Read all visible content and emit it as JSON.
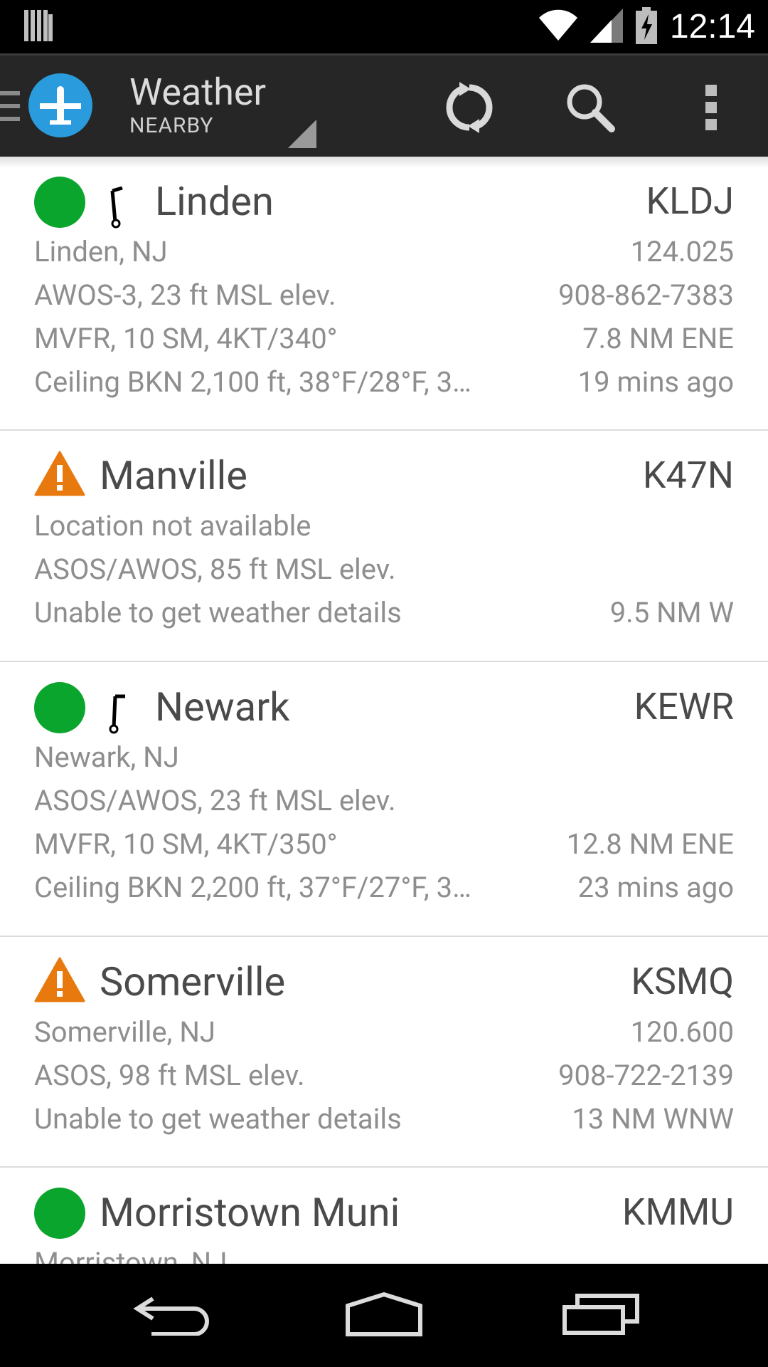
{
  "status_bar": {
    "time": "12:14",
    "icons": [
      "sd-card-icon",
      "wifi-icon",
      "cell-signal-icon",
      "battery-charging-icon"
    ]
  },
  "action_bar": {
    "title": "Weather",
    "subtitle": "NEARBY",
    "icons": [
      "drawer-indicator-icon",
      "airplane-app-icon",
      "refresh-icon",
      "search-icon",
      "overflow-menu-icon"
    ],
    "app_icon_color": "#2a9bdc"
  },
  "stations": [
    {
      "status": "vfr",
      "name": "Linden",
      "ident": "KLDJ",
      "has_wind": true,
      "rows": [
        {
          "left": "Linden, NJ",
          "right": "124.025"
        },
        {
          "left": "AWOS-3, 23 ft MSL elev.",
          "right": "908-862-7383"
        },
        {
          "left": "MVFR, 10 SM, 4KT/340°",
          "right": "7.8 NM ENE"
        },
        {
          "left": "Ceiling BKN 2,100 ft, 38°F/28°F, 3…",
          "right": "19 mins ago"
        }
      ]
    },
    {
      "status": "warning",
      "name": "Manville",
      "ident": "K47N",
      "has_wind": false,
      "rows": [
        {
          "left": "Location not available",
          "right": ""
        },
        {
          "left": "ASOS/AWOS, 85 ft MSL elev.",
          "right": ""
        },
        {
          "left": "Unable to get weather details",
          "right": "9.5 NM W"
        }
      ]
    },
    {
      "status": "vfr",
      "name": "Newark",
      "ident": "KEWR",
      "has_wind": true,
      "rows": [
        {
          "left": "Newark, NJ",
          "right": ""
        },
        {
          "left": "ASOS/AWOS, 23 ft MSL elev.",
          "right": ""
        },
        {
          "left": "MVFR, 10 SM, 4KT/350°",
          "right": "12.8 NM ENE"
        },
        {
          "left": "Ceiling BKN 2,200 ft, 37°F/27°F, 3…",
          "right": "23 mins ago"
        }
      ]
    },
    {
      "status": "warning",
      "name": "Somerville",
      "ident": "KSMQ",
      "has_wind": false,
      "rows": [
        {
          "left": "Somerville, NJ",
          "right": "120.600"
        },
        {
          "left": "ASOS, 98 ft MSL elev.",
          "right": "908-722-2139"
        },
        {
          "left": "Unable to get weather details",
          "right": "13 NM WNW"
        }
      ]
    },
    {
      "status": "vfr",
      "name": "Morristown Muni",
      "ident": "KMMU",
      "has_wind": false,
      "rows": [
        {
          "left": "Morristown, NJ",
          "right": ""
        }
      ]
    }
  ],
  "colors": {
    "vfr_green": "#0aa52c",
    "warning_orange": "#e8790f",
    "primary_text": "#4a4a4a",
    "secondary_text": "#8e8e8e"
  },
  "nav_bar": {
    "icons": [
      "back-icon",
      "home-icon",
      "recent-apps-icon"
    ]
  }
}
